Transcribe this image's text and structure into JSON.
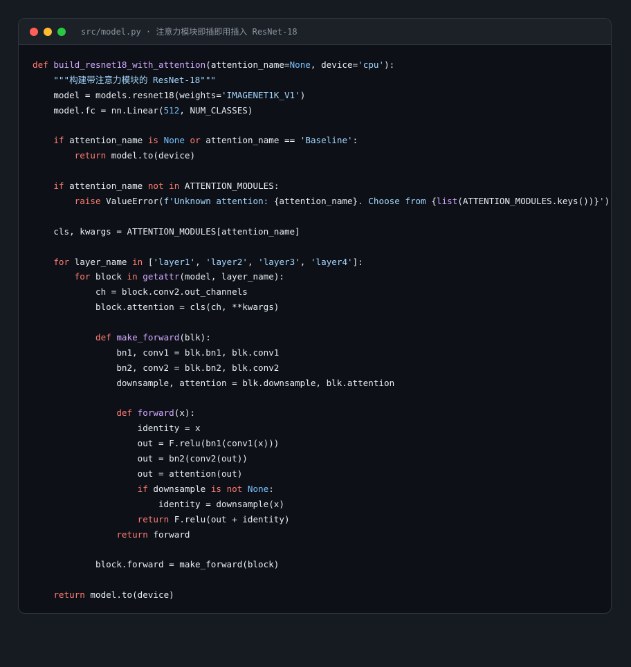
{
  "window": {
    "title": "src/model.py · 注意力模块即插即用插入 ResNet-18",
    "controls": {
      "close_color": "#ff5f57",
      "minimize_color": "#febc2e",
      "maximize_color": "#28c840"
    }
  },
  "theme": {
    "background": "#0d1117",
    "text": "#e6edf3",
    "keyword": "#ff7b72",
    "function": "#d2a8ff",
    "string": "#a5d6ff",
    "constant": "#79c0ff"
  },
  "code_lines": [
    [
      [
        "k",
        "def "
      ],
      [
        "f",
        "build_resnet18_with_attention"
      ],
      [
        "t",
        "(attention_name="
      ],
      [
        "c",
        "None"
      ],
      [
        "t",
        ", device="
      ],
      [
        "s",
        "'cpu'"
      ],
      [
        "t",
        "):"
      ]
    ],
    [
      [
        "t",
        "    "
      ],
      [
        "s",
        "\"\"\"构建带注意力模块的 ResNet-18\"\"\""
      ]
    ],
    [
      [
        "t",
        "    model = models.resnet18(weights="
      ],
      [
        "s",
        "'IMAGENET1K_V1'"
      ],
      [
        "t",
        ")"
      ]
    ],
    [
      [
        "t",
        "    model.fc = nn.Linear("
      ],
      [
        "c",
        "512"
      ],
      [
        "t",
        ", NUM_CLASSES)"
      ]
    ],
    [],
    [
      [
        "t",
        "    "
      ],
      [
        "k",
        "if"
      ],
      [
        "t",
        " attention_name "
      ],
      [
        "k",
        "is"
      ],
      [
        "t",
        " "
      ],
      [
        "c",
        "None"
      ],
      [
        "t",
        " "
      ],
      [
        "k",
        "or"
      ],
      [
        "t",
        " attention_name == "
      ],
      [
        "s",
        "'Baseline'"
      ],
      [
        "t",
        ":"
      ]
    ],
    [
      [
        "t",
        "        "
      ],
      [
        "k",
        "return"
      ],
      [
        "t",
        " model.to(device)"
      ]
    ],
    [],
    [
      [
        "t",
        "    "
      ],
      [
        "k",
        "if"
      ],
      [
        "t",
        " attention_name "
      ],
      [
        "k",
        "not in"
      ],
      [
        "t",
        " ATTENTION_MODULES:"
      ]
    ],
    [
      [
        "t",
        "        "
      ],
      [
        "k",
        "raise"
      ],
      [
        "t",
        " ValueError("
      ],
      [
        "s",
        "f'Unknown attention: "
      ],
      [
        "t",
        "{attention_name}"
      ],
      [
        "s",
        ". Choose from "
      ],
      [
        "t",
        "{"
      ],
      [
        "f",
        "list"
      ],
      [
        "t",
        "(ATTENTION_MODULES.keys())}"
      ],
      [
        "s",
        "'"
      ],
      [
        "t",
        ")"
      ]
    ],
    [],
    [
      [
        "t",
        "    cls, kwargs = ATTENTION_MODULES[attention_name]"
      ]
    ],
    [],
    [
      [
        "t",
        "    "
      ],
      [
        "k",
        "for"
      ],
      [
        "t",
        " layer_name "
      ],
      [
        "k",
        "in"
      ],
      [
        "t",
        " ["
      ],
      [
        "s",
        "'layer1'"
      ],
      [
        "t",
        ", "
      ],
      [
        "s",
        "'layer2'"
      ],
      [
        "t",
        ", "
      ],
      [
        "s",
        "'layer3'"
      ],
      [
        "t",
        ", "
      ],
      [
        "s",
        "'layer4'"
      ],
      [
        "t",
        "]:"
      ]
    ],
    [
      [
        "t",
        "        "
      ],
      [
        "k",
        "for"
      ],
      [
        "t",
        " block "
      ],
      [
        "k",
        "in"
      ],
      [
        "t",
        " "
      ],
      [
        "f",
        "getattr"
      ],
      [
        "t",
        "(model, layer_name):"
      ]
    ],
    [
      [
        "t",
        "            ch = block.conv2.out_channels"
      ]
    ],
    [
      [
        "t",
        "            block.attention = cls(ch, **kwargs)"
      ]
    ],
    [],
    [
      [
        "t",
        "            "
      ],
      [
        "k",
        "def "
      ],
      [
        "f",
        "make_forward"
      ],
      [
        "t",
        "(blk):"
      ]
    ],
    [
      [
        "t",
        "                bn1, conv1 = blk.bn1, blk.conv1"
      ]
    ],
    [
      [
        "t",
        "                bn2, conv2 = blk.bn2, blk.conv2"
      ]
    ],
    [
      [
        "t",
        "                downsample, attention = blk.downsample, blk.attention"
      ]
    ],
    [],
    [
      [
        "t",
        "                "
      ],
      [
        "k",
        "def "
      ],
      [
        "f",
        "forward"
      ],
      [
        "t",
        "(x):"
      ]
    ],
    [
      [
        "t",
        "                    identity = x"
      ]
    ],
    [
      [
        "t",
        "                    out = F.relu(bn1(conv1(x)))"
      ]
    ],
    [
      [
        "t",
        "                    out = bn2(conv2(out))"
      ]
    ],
    [
      [
        "t",
        "                    out = attention(out)"
      ]
    ],
    [
      [
        "t",
        "                    "
      ],
      [
        "k",
        "if"
      ],
      [
        "t",
        " downsample "
      ],
      [
        "k",
        "is not"
      ],
      [
        "t",
        " "
      ],
      [
        "c",
        "None"
      ],
      [
        "t",
        ":"
      ]
    ],
    [
      [
        "t",
        "                        identity = downsample(x)"
      ]
    ],
    [
      [
        "t",
        "                    "
      ],
      [
        "k",
        "return"
      ],
      [
        "t",
        " F.relu(out + identity)"
      ]
    ],
    [
      [
        "t",
        "                "
      ],
      [
        "k",
        "return"
      ],
      [
        "t",
        " forward"
      ]
    ],
    [],
    [
      [
        "t",
        "            block.forward = make_forward(block)"
      ]
    ],
    [],
    [
      [
        "t",
        "    "
      ],
      [
        "k",
        "return"
      ],
      [
        "t",
        " model.to(device)"
      ]
    ]
  ]
}
